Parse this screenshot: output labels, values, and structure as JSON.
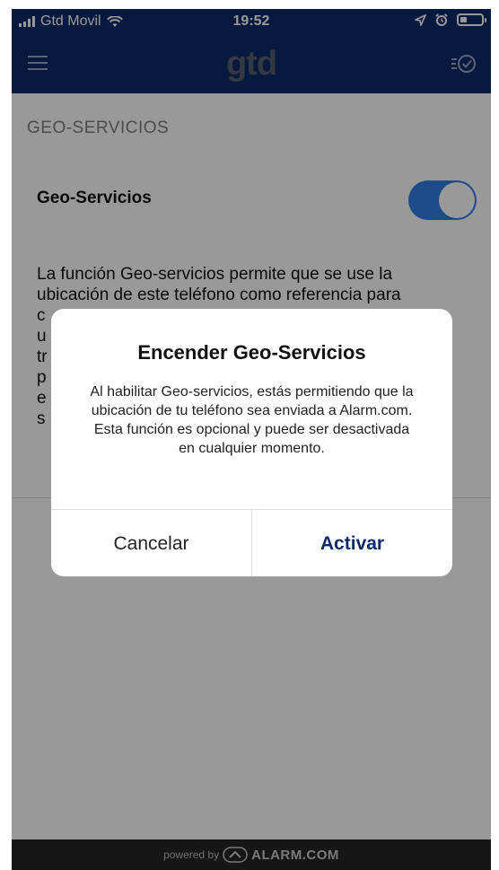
{
  "status_bar": {
    "carrier": "Gtd Movil",
    "time": "19:52",
    "battery_level": 0.3,
    "icons": [
      "signal-icon",
      "wifi-icon",
      "location-icon",
      "alarm-clock-icon",
      "battery-icon"
    ]
  },
  "header": {
    "logo": "gtd",
    "menu_icon": "hamburger-menu-icon",
    "tasks_icon": "task-list-check-icon"
  },
  "settings": {
    "section_title": "GEO-SERVICIOS",
    "toggle_label": "Geo-Servicios",
    "toggle_on": true,
    "description_line1": "La función Geo-servicios permite que se use la",
    "description_line2": "ubicación de este teléfono como referencia para",
    "description_partial": [
      "c",
      "u",
      "tr",
      "p",
      "e",
      "s"
    ]
  },
  "dialog": {
    "title": "Encender Geo-Servicios",
    "message": "Al habilitar Geo-servicios, estás permitiendo que la ubicación de tu teléfono sea enviada a Alarm.com. Esta función es opcional y puede ser desactivada en cualquier momento.",
    "cancel_label": "Cancelar",
    "confirm_label": "Activar"
  },
  "footer": {
    "powered_by": "powered by",
    "brand": "ALARM.COM"
  },
  "colors": {
    "header_bg": "#0c2a6a",
    "toggle_on": "#2f7ee6",
    "confirm_text": "#0c2a6a"
  }
}
